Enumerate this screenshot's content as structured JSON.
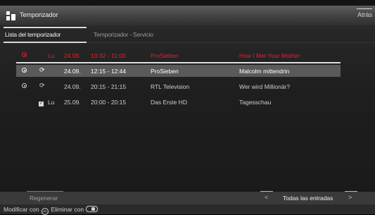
{
  "header": {
    "title": "Temporizador",
    "back_label": "Atrás"
  },
  "tabs": [
    {
      "label": "Lista del temporizador",
      "active": true
    },
    {
      "label": "Temporizador - Servicio",
      "active": false
    }
  ],
  "timers": [
    {
      "status": "recording",
      "day": "Lu",
      "date": "24.09.",
      "time": "10:32 - 11:00",
      "channel": "ProSieben",
      "program": "How I Met Your Mother",
      "color": "#e8202a"
    },
    {
      "status": "scheduled",
      "repeat_icon": "repeat-icon",
      "date": "24.09.",
      "time": "12:15 - 12:44",
      "channel": "ProSieben",
      "program": "Malcolm mittendrin",
      "selected": true
    },
    {
      "status": "scheduled",
      "repeat_icon": "repeat-icon",
      "date": "24.09.",
      "time": "20:15 - 21:15",
      "channel": "RTL Television",
      "program": "Wer wird Millionär?"
    },
    {
      "status": "checked",
      "day": "Lu",
      "date": "25.09.",
      "time": "20:00 - 20:15",
      "channel": "Das Erste HD",
      "program": "Tagesschau"
    }
  ],
  "bottom_bar": {
    "regen_label": "Regenerar",
    "prev_label": "<",
    "filter_label": "Todas las entradas",
    "next_label": ">"
  },
  "footer": {
    "modify_label": "Modificar con",
    "ok_icon_text": "OK",
    "delete_label": "Eliminar con"
  }
}
